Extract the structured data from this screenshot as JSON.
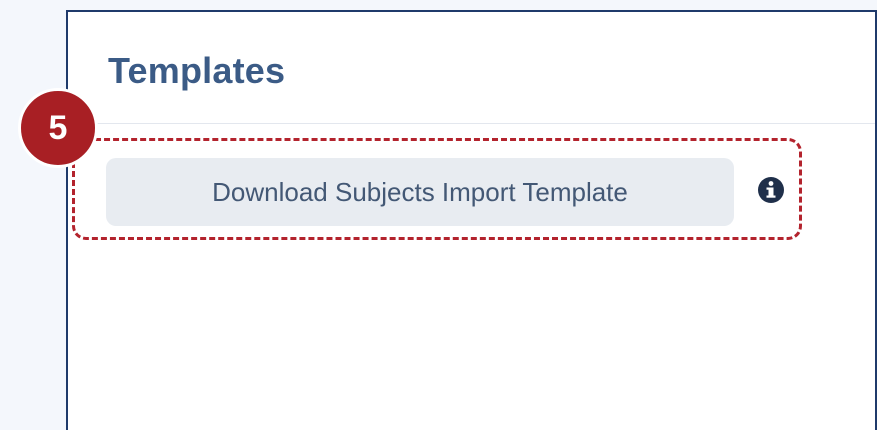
{
  "panel": {
    "title": "Templates"
  },
  "step_badge": {
    "number": "5"
  },
  "download_button": {
    "label": "Download Subjects Import Template"
  },
  "icons": {
    "info": "info-icon"
  },
  "colors": {
    "badge": "#a81f24",
    "dashed_border": "#b3232d",
    "title": "#3b5b86",
    "button_bg": "#e8ecf1"
  }
}
